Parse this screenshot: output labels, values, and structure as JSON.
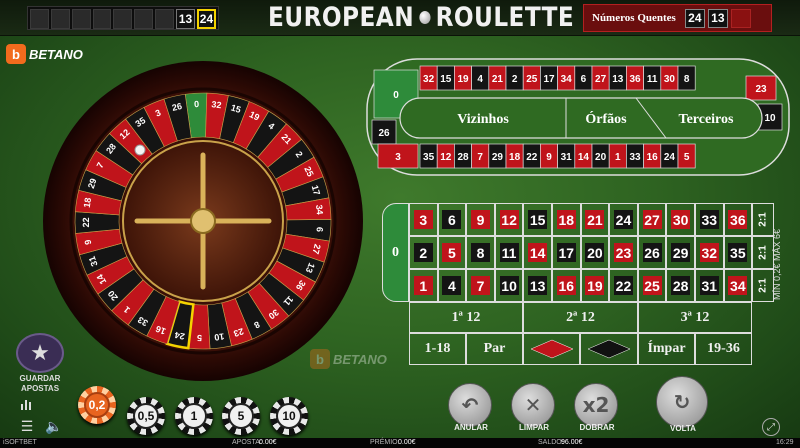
{
  "title": {
    "left": "EUROPEAN",
    "right": "ROULETTE"
  },
  "history": {
    "cells": [
      "",
      "",
      "",
      "",
      "",
      "",
      "",
      "13",
      "24"
    ]
  },
  "hot_numbers": {
    "label": "Números Quentes",
    "numbers": [
      "24",
      "13",
      ""
    ]
  },
  "brand": {
    "name": "BETANO",
    "mark": "b"
  },
  "wheel": {
    "sequence": [
      0,
      32,
      15,
      19,
      4,
      21,
      2,
      25,
      17,
      34,
      6,
      27,
      13,
      36,
      11,
      30,
      8,
      23,
      10,
      5,
      24,
      16,
      33,
      1,
      20,
      14,
      31,
      9,
      22,
      18,
      29,
      7,
      28,
      12,
      35,
      3,
      26
    ],
    "highlighted": 24
  },
  "racetrack": {
    "top": [
      "32",
      "15",
      "19",
      "4",
      "21",
      "2",
      "25",
      "17",
      "34",
      "6",
      "27",
      "13",
      "36",
      "11",
      "30",
      "8"
    ],
    "bottom": [
      "35",
      "12",
      "28",
      "7",
      "29",
      "18",
      "22",
      "9",
      "31",
      "14",
      "20",
      "1",
      "33",
      "16",
      "24",
      "5"
    ],
    "left": [
      "0",
      "26",
      "3"
    ],
    "right": [
      "23",
      "10"
    ],
    "sections": [
      "Vizinhos",
      "Órfãos",
      "Terceiros"
    ]
  },
  "table": {
    "zero": "0",
    "rows": [
      [
        "3",
        "6",
        "9",
        "12",
        "15",
        "18",
        "21",
        "24",
        "27",
        "30",
        "33",
        "36"
      ],
      [
        "2",
        "5",
        "8",
        "11",
        "14",
        "17",
        "20",
        "23",
        "26",
        "29",
        "32",
        "35"
      ],
      [
        "1",
        "4",
        "7",
        "10",
        "13",
        "16",
        "19",
        "22",
        "25",
        "28",
        "31",
        "34"
      ]
    ],
    "reds": [
      "1",
      "3",
      "5",
      "7",
      "9",
      "12",
      "14",
      "16",
      "18",
      "19",
      "21",
      "23",
      "25",
      "27",
      "30",
      "32",
      "34",
      "36"
    ],
    "columns": [
      "2:1",
      "2:1",
      "2:1"
    ],
    "dozens": [
      "1ª 12",
      "2ª 12",
      "3ª 12"
    ],
    "even_money": {
      "low": "1-18",
      "even": "Par",
      "odd": "Ímpar",
      "high": "19-36"
    },
    "limits": "MÍN 0,2€ MÁX 6€",
    "colors": {
      "red": "#c0141b",
      "black": "#141414",
      "green": "#2e8b3a"
    }
  },
  "save_bets": {
    "label1": "GUARDAR",
    "label2": "APOSTAS"
  },
  "chips": [
    "0,2",
    "0,5",
    "1",
    "5",
    "10"
  ],
  "selected_chip": "0,2",
  "actions": {
    "undo": "ANULAR",
    "clear": "LIMPAR",
    "double": "DOBRAR",
    "double_symbol": "x2",
    "spin": "VOLTA"
  },
  "status": {
    "provider": "iSOFTBET",
    "bet_label": "APOSTA:",
    "bet_value": "0.00€",
    "win_label": "PRÉMIO:",
    "win_value": "0.00€",
    "balance_label": "SALDO:",
    "balance_value": "96.00€",
    "clock": "16:29"
  },
  "icons": [
    "star-icon",
    "stats-icon",
    "sound-icon",
    "menu-icon",
    "undo-icon",
    "close-icon",
    "spin-icon",
    "fullscreen-icon"
  ]
}
